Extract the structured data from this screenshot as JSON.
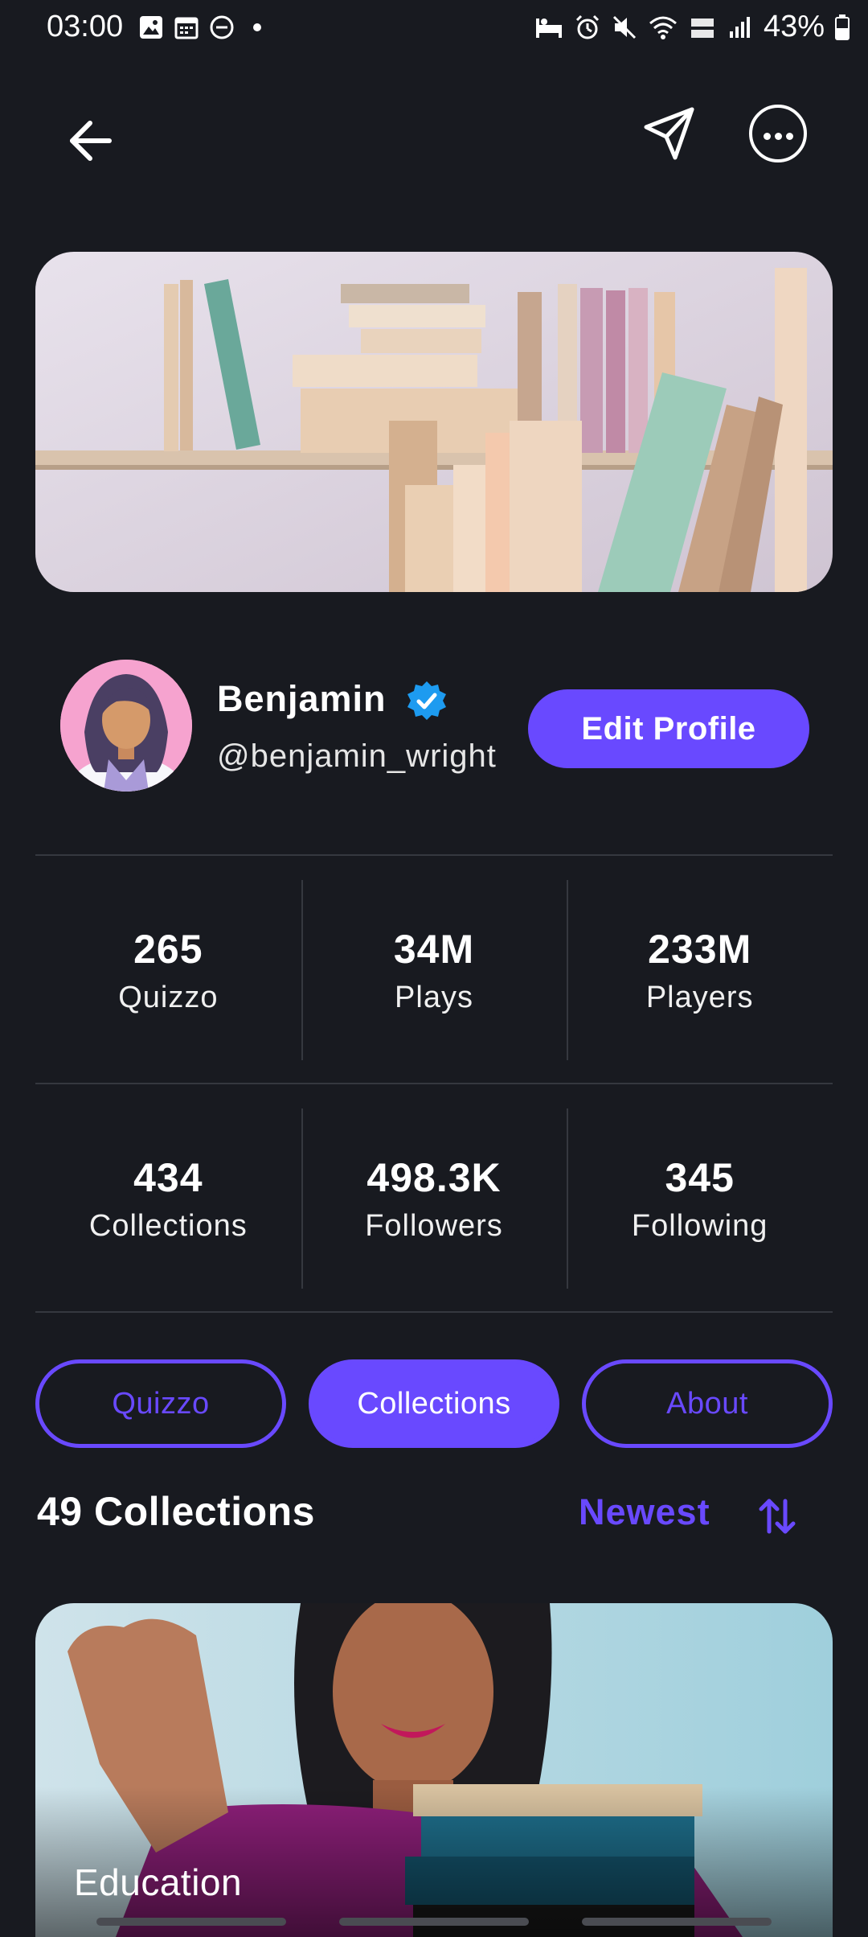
{
  "status": {
    "time": "03:00",
    "battery": "43%"
  },
  "profile": {
    "name": "Benjamin",
    "handle": "@benjamin_wright",
    "edit_label": "Edit Profile",
    "verified": true
  },
  "stats_row1": [
    {
      "value": "265",
      "label": "Quizzo"
    },
    {
      "value": "34M",
      "label": "Plays"
    },
    {
      "value": "233M",
      "label": "Players"
    }
  ],
  "stats_row2": [
    {
      "value": "434",
      "label": "Collections"
    },
    {
      "value": "498.3K",
      "label": "Followers"
    },
    {
      "value": "345",
      "label": "Following"
    }
  ],
  "tabs": [
    {
      "label": "Quizzo",
      "active": false
    },
    {
      "label": "Collections",
      "active": true
    },
    {
      "label": "About",
      "active": false
    }
  ],
  "collections": {
    "title": "49 Collections",
    "sort": "Newest",
    "cards": [
      {
        "label": "Education"
      }
    ]
  },
  "colors": {
    "accent": "#6949ff",
    "background": "#181a20",
    "divider": "#35383f",
    "verified": "#1d9bf0"
  },
  "icons": [
    "back-arrow-icon",
    "send-icon",
    "more-icon",
    "verified-badge-icon",
    "sort-icon"
  ]
}
